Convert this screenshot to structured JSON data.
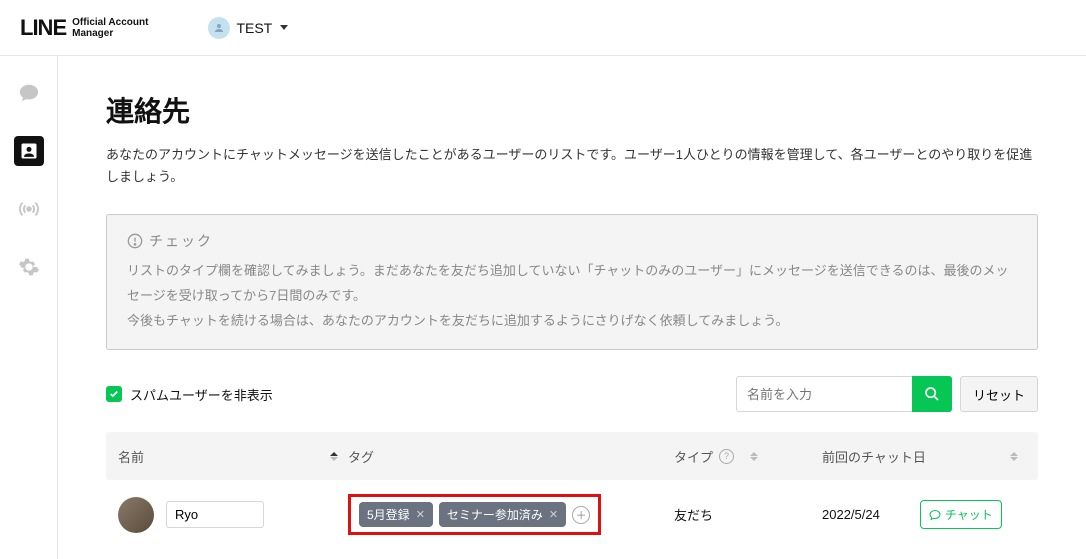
{
  "header": {
    "logo_main": "LINE",
    "logo_sub1": "Official Account",
    "logo_sub2": "Manager",
    "account_name": "TEST"
  },
  "page": {
    "title": "連絡先",
    "description": "あなたのアカウントにチャットメッセージを送信したことがあるユーザーのリストです。ユーザー1人ひとりの情報を管理して、各ユーザーとのやり取りを促進しましょう。"
  },
  "info_box": {
    "title": "チェック",
    "body": "リストのタイプ欄を確認してみましょう。まだあなたを友だち追加していない「チャットのみのユーザー」にメッセージを送信できるのは、最後のメッセージを受け取ってから7日間のみです。\n今後もチャットを続ける場合は、あなたのアカウントを友だちに追加するようにさりげなく依頼してみましょう。"
  },
  "controls": {
    "hide_spam_label": "スパムユーザーを非表示",
    "search_placeholder": "名前を入力",
    "reset_label": "リセット"
  },
  "table": {
    "headers": {
      "name": "名前",
      "tags": "タグ",
      "type": "タイプ",
      "last_chat": "前回のチャット日"
    },
    "rows": [
      {
        "name_value": "Ryo",
        "tags": [
          "5月登録",
          "セミナー参加済み"
        ],
        "type": "友だち",
        "last_chat": "2022/5/24",
        "chat_button": "チャット"
      }
    ]
  }
}
